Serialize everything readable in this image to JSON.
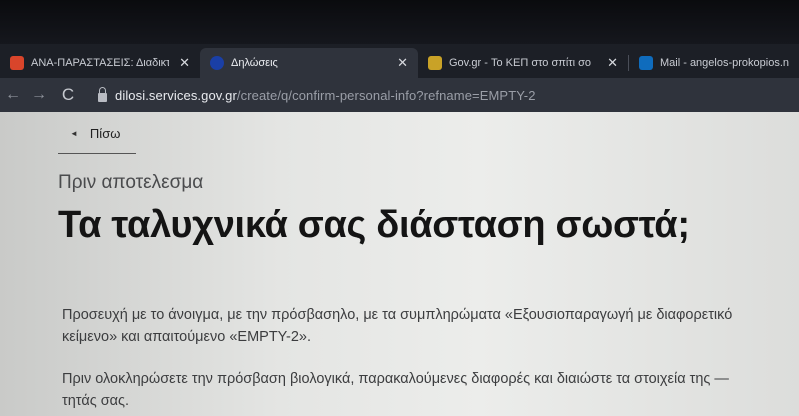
{
  "browser": {
    "tabs": [
      {
        "title": "ΑΝΑ-ΠΑΡΑΣΤΑΣΕΙΣ: Διαδικτυ",
        "close": "✕",
        "favicon_color": "#d9452b",
        "active": false
      },
      {
        "title": "Δηλώσεις",
        "close": "✕",
        "favicon_color": "#1a3fa6",
        "active": true
      },
      {
        "title": "Gov.gr - Το ΚΕΠ στο σπίτι σο",
        "close": "✕",
        "favicon_color": "#c9a227",
        "active": false
      },
      {
        "title": "Mail - angelos-prokopios.ne",
        "close": "",
        "favicon_color": "#0f6cbd",
        "active": false
      }
    ],
    "nav": {
      "back": "←",
      "forward": "→",
      "reload": "C"
    },
    "url": {
      "domain": "dilosi.services.gov.gr",
      "path": "/create/q/confirm-personal-info?refname=EMPTY-2"
    }
  },
  "page": {
    "back_chevron": "◄",
    "back_label": "Πίσω",
    "caption": "Πριν αποτελεσμα",
    "heading": "Τα ταλυχνικά σας διάσταση σωστά;",
    "paragraph1": "Προσευχή με το άνοιγμα, με την πρόσβασηλο, με τα συμπληρώματα «Εξουσιοπαραγωγή με διαφορετικό κείμενο» και απαιτούμενο «EMPTY-2».",
    "paragraph2": "Πριν ολοκληρώσετε την πρόσβαση βιολογικά, παρακαλούμενες διαφορές και διαιώστε τα στοιχεία της —τητάς σας."
  }
}
